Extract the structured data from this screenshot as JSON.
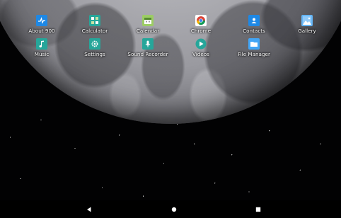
{
  "apps_row1": [
    {
      "label": "About 900",
      "icon": "about-icon",
      "color": "#1e88e5"
    },
    {
      "label": "Calculator",
      "icon": "calculator-icon",
      "color": "#26a69a"
    },
    {
      "label": "Calendar",
      "icon": "calendar-icon",
      "color": "#8bc34a"
    },
    {
      "label": "Chrome",
      "icon": "chrome-icon",
      "color": "#ffffff"
    },
    {
      "label": "Contacts",
      "icon": "contacts-icon",
      "color": "#1e88e5"
    },
    {
      "label": "Gallery",
      "icon": "gallery-icon",
      "color": "#42a5f5"
    }
  ],
  "apps_row2": [
    {
      "label": "Music",
      "icon": "music-icon",
      "color": "#26a69a"
    },
    {
      "label": "Settings",
      "icon": "settings-icon",
      "color": "#26a69a"
    },
    {
      "label": "Sound Recorder",
      "icon": "microphone-icon",
      "color": "#26a69a"
    },
    {
      "label": "Videos",
      "icon": "play-icon",
      "color": "#26a69a"
    },
    {
      "label": "File Manager",
      "icon": "folder-icon",
      "color": "#42a5f5"
    }
  ],
  "nav": {
    "back": "back-icon",
    "home": "home-icon",
    "recents": "recents-icon"
  }
}
